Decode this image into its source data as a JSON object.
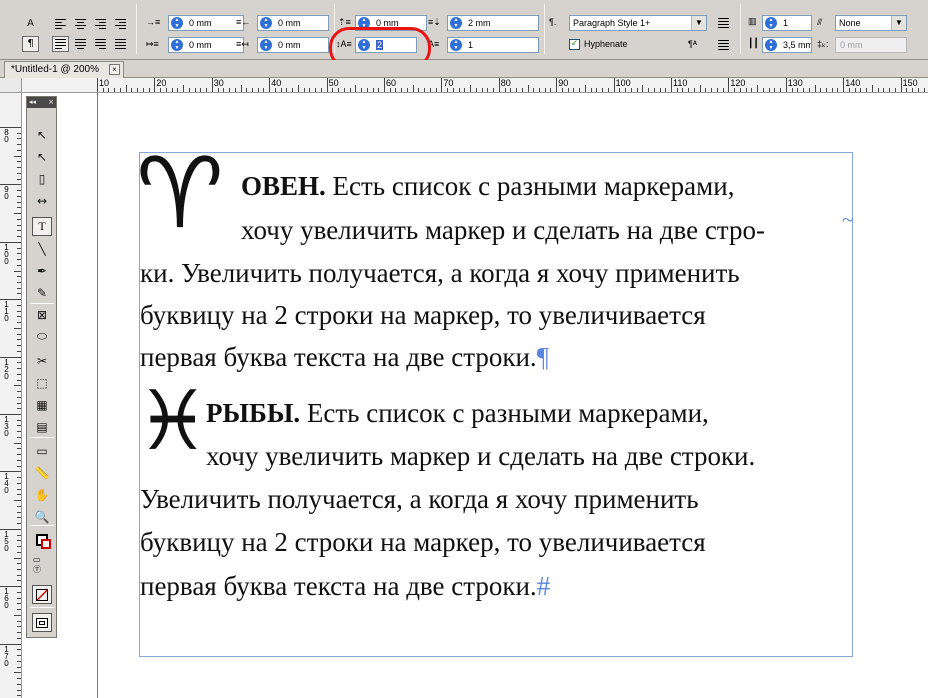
{
  "control_panel": {
    "left_indent": "0 mm",
    "right_indent": "0 mm",
    "first_line_indent": "0 mm",
    "last_line_indent": "0 mm",
    "space_before": "0 mm",
    "space_after": "2 mm",
    "drop_cap_lines": "2",
    "drop_cap_chars": "1",
    "paragraph_style": "Paragraph Style 1+",
    "hyphenate_label": "Hyphenate",
    "hyphenate_checked": true,
    "columns": "1",
    "gutter": "3,5 mm",
    "column_span": "None",
    "span_width": "0 mm"
  },
  "document_tab": {
    "title": "*Untitled-1 @ 200%",
    "close_glyph": "×"
  },
  "ruler": {
    "horizontal_labels": [
      "10",
      "20",
      "30",
      "40",
      "50",
      "60",
      "70",
      "80",
      "90",
      "100",
      "110",
      "120",
      "130",
      "140",
      "150"
    ],
    "vertical_labels": [
      "80",
      "90",
      "100",
      "110",
      "120",
      "130",
      "140",
      "150",
      "160",
      "170"
    ]
  },
  "document_text": {
    "p1_dropcap": "♈",
    "p1_line1_bold": "ОВЕН.",
    "p1_line1": " Есть список с разными маркерами,",
    "p1_line2": "хочу увеличить маркер и сделать на две стро-",
    "p1_line2_mark": "~",
    "p1_line3": "ки. Увеличить получается, а когда я хочу применить",
    "p1_line4": "буквицу на 2 строки на маркер, то увеличивается",
    "p1_line5": "первая буква текста на две строки.",
    "p1_end_mark": "¶",
    "p2_dropcap": "♓",
    "p2_line1_bold": "РЫБЫ.",
    "p2_line1": " Есть список с разными маркерами,",
    "p2_line2": "хочу увеличить маркер и сделать на две строки.",
    "p2_line3": "Увеличить получается, а когда я хочу применить",
    "p2_line4": "буквицу на 2 строки на маркер, то увеличивается",
    "p2_line5": "первая буква текста на две строки.",
    "p2_end_mark": "#"
  },
  "tools_panel": {
    "collapse_glyph": "◂◂",
    "close_glyph": "×",
    "tools": [
      {
        "name": "selection-tool",
        "glyph": "↖"
      },
      {
        "name": "direct-selection-tool",
        "glyph": "↖"
      },
      {
        "name": "page-tool",
        "glyph": "▯"
      },
      {
        "name": "gap-tool",
        "glyph": "↔"
      },
      {
        "name": "type-tool",
        "glyph": "T"
      },
      {
        "name": "line-tool",
        "glyph": "╲"
      },
      {
        "name": "pen-tool",
        "glyph": "✒"
      },
      {
        "name": "pencil-tool",
        "glyph": "✎"
      },
      {
        "name": "rectangle-frame-tool",
        "glyph": "⊠"
      },
      {
        "name": "ellipse-tool",
        "glyph": "⬭"
      },
      {
        "name": "scissors-tool",
        "glyph": "✂"
      },
      {
        "name": "free-transform-tool",
        "glyph": "⬚"
      },
      {
        "name": "gradient-tool",
        "glyph": "▦"
      },
      {
        "name": "gradient-feather-tool",
        "glyph": "▤"
      },
      {
        "name": "note-tool",
        "glyph": "▭"
      },
      {
        "name": "measure-tool",
        "glyph": "📏"
      },
      {
        "name": "hand-tool",
        "glyph": "✋"
      },
      {
        "name": "zoom-tool",
        "glyph": "🔍"
      }
    ]
  },
  "colors": {
    "panel": "#d6d3ce",
    "frame_edge": "#86a7d9",
    "margin_guide": "#c0509b",
    "highlight": "#e81313",
    "hidden_char": "#5a86e0"
  }
}
